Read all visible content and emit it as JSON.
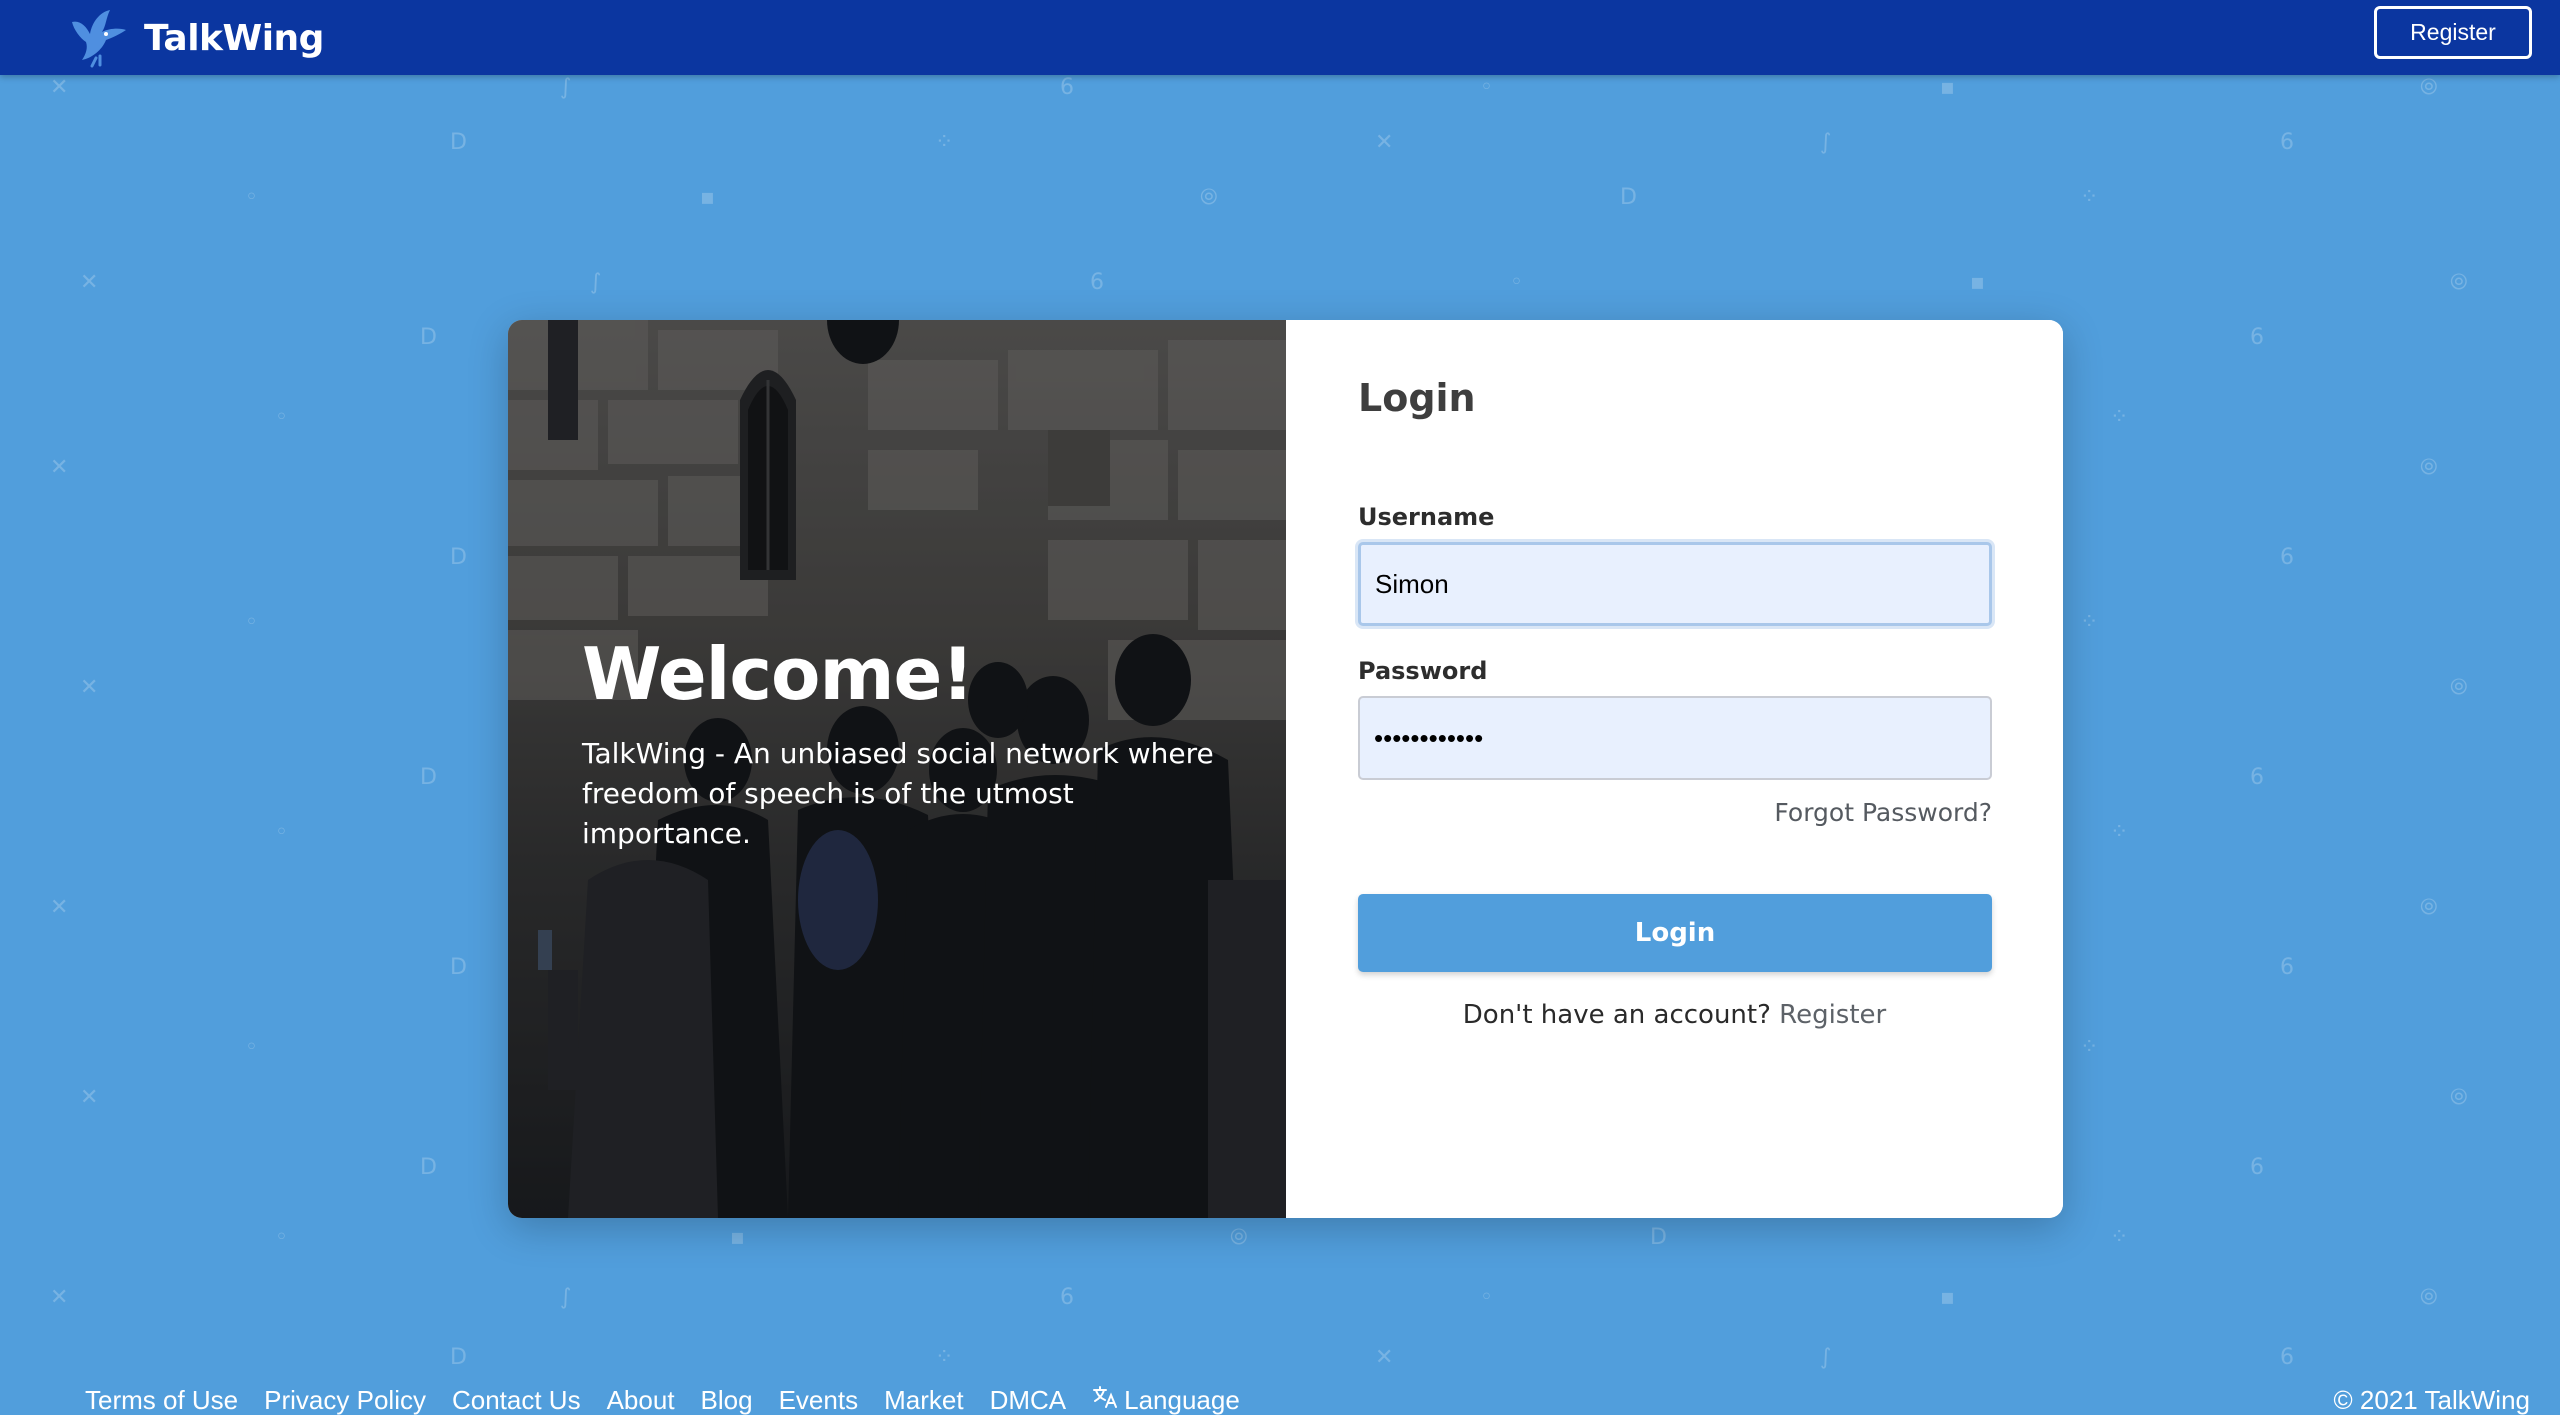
{
  "header": {
    "brand_name": "TalkWing",
    "register_label": "Register"
  },
  "hero": {
    "title": "Welcome!",
    "subtitle": "TalkWing - An unbiased social network where freedom of speech is of the utmost importance."
  },
  "login_form": {
    "title": "Login",
    "username_label": "Username",
    "username_value": "Simon",
    "password_label": "Password",
    "password_value": "••••••••••••",
    "forgot_password": "Forgot Password?",
    "login_button": "Login",
    "no_account_text": "Don't have an account?",
    "register_link": "Register"
  },
  "footer": {
    "links": [
      "Terms of Use",
      "Privacy Policy",
      "Contact Us",
      "About",
      "Blog",
      "Events",
      "Market",
      "DMCA"
    ],
    "language_label": "Language",
    "copyright": "© 2021 TalkWing"
  },
  "colors": {
    "header_bg": "#0b36a0",
    "page_bg": "#519edc",
    "button_bg": "#519edc",
    "input_bg": "#e8f0fe"
  },
  "icons": {
    "brand": "dove-icon",
    "language": "translate-icon"
  }
}
